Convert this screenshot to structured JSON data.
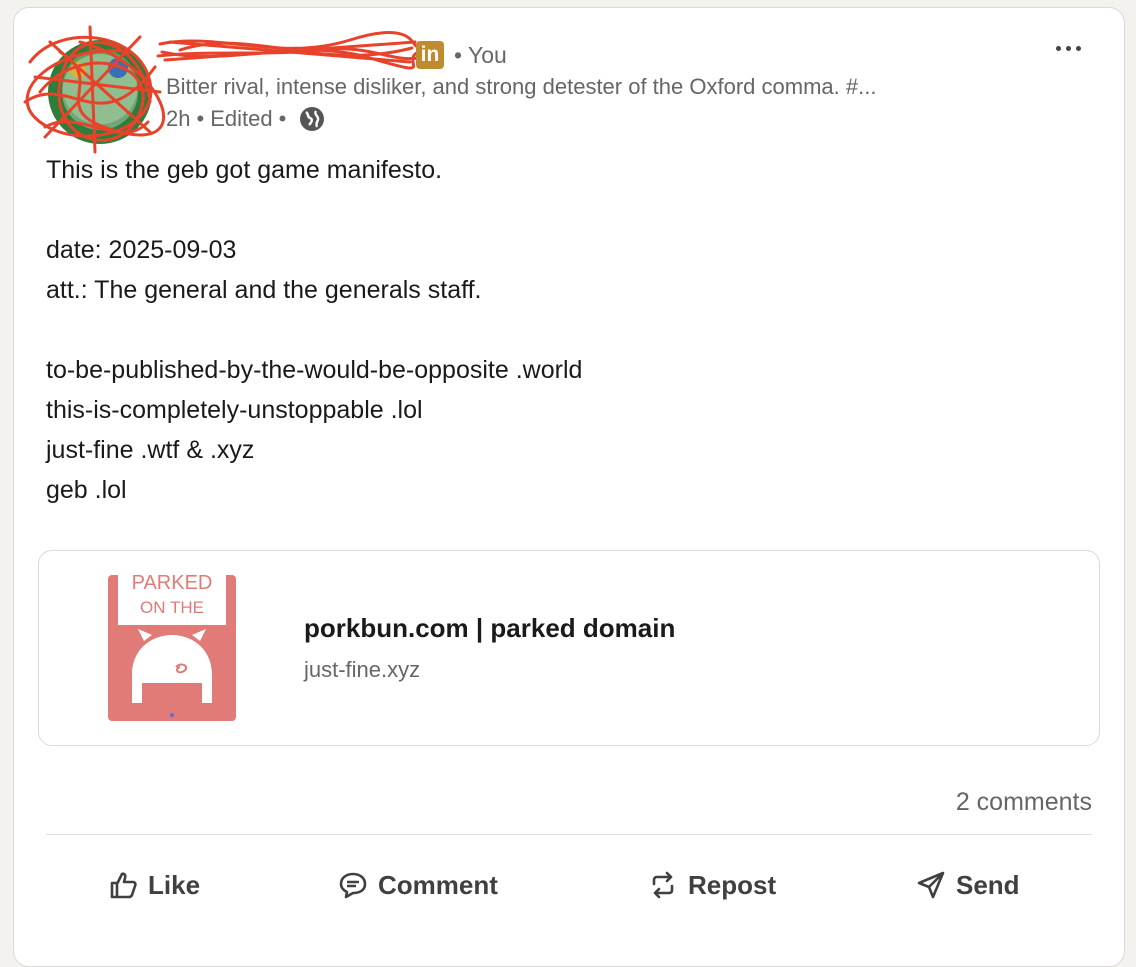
{
  "post": {
    "author_degree": "• You",
    "linkedin_badge": "in",
    "headline": "Bitter rival, intense disliker, and strong detester of the Oxford comma. #...",
    "time": "2h",
    "sep1": "•",
    "edited": "Edited",
    "sep2": "•",
    "visibility_icon": "globe-icon",
    "menu_icon": "ellipsis-icon",
    "body_lines": [
      "This is the geb got game manifesto.",
      "",
      "date: 2025-09-03",
      "att.: The general and the generals staff.",
      "",
      "to-be-published-by-the-would-be-opposite .world",
      "this-is-completely-unstoppable .lol",
      "just-fine .wtf & .xyz",
      "geb .lol"
    ]
  },
  "link_preview": {
    "thumb_text_1": "PARKED",
    "thumb_text_2": "ON THE",
    "title": "porkbun.com | parked domain",
    "domain": "just-fine.xyz"
  },
  "social": {
    "comments": "2 comments"
  },
  "actions": {
    "like": "Like",
    "comment": "Comment",
    "repost": "Repost",
    "send": "Send"
  },
  "colors": {
    "badge": "#c08a2e",
    "redaction": "#e8432a",
    "thumb_bg": "#e07b77"
  }
}
